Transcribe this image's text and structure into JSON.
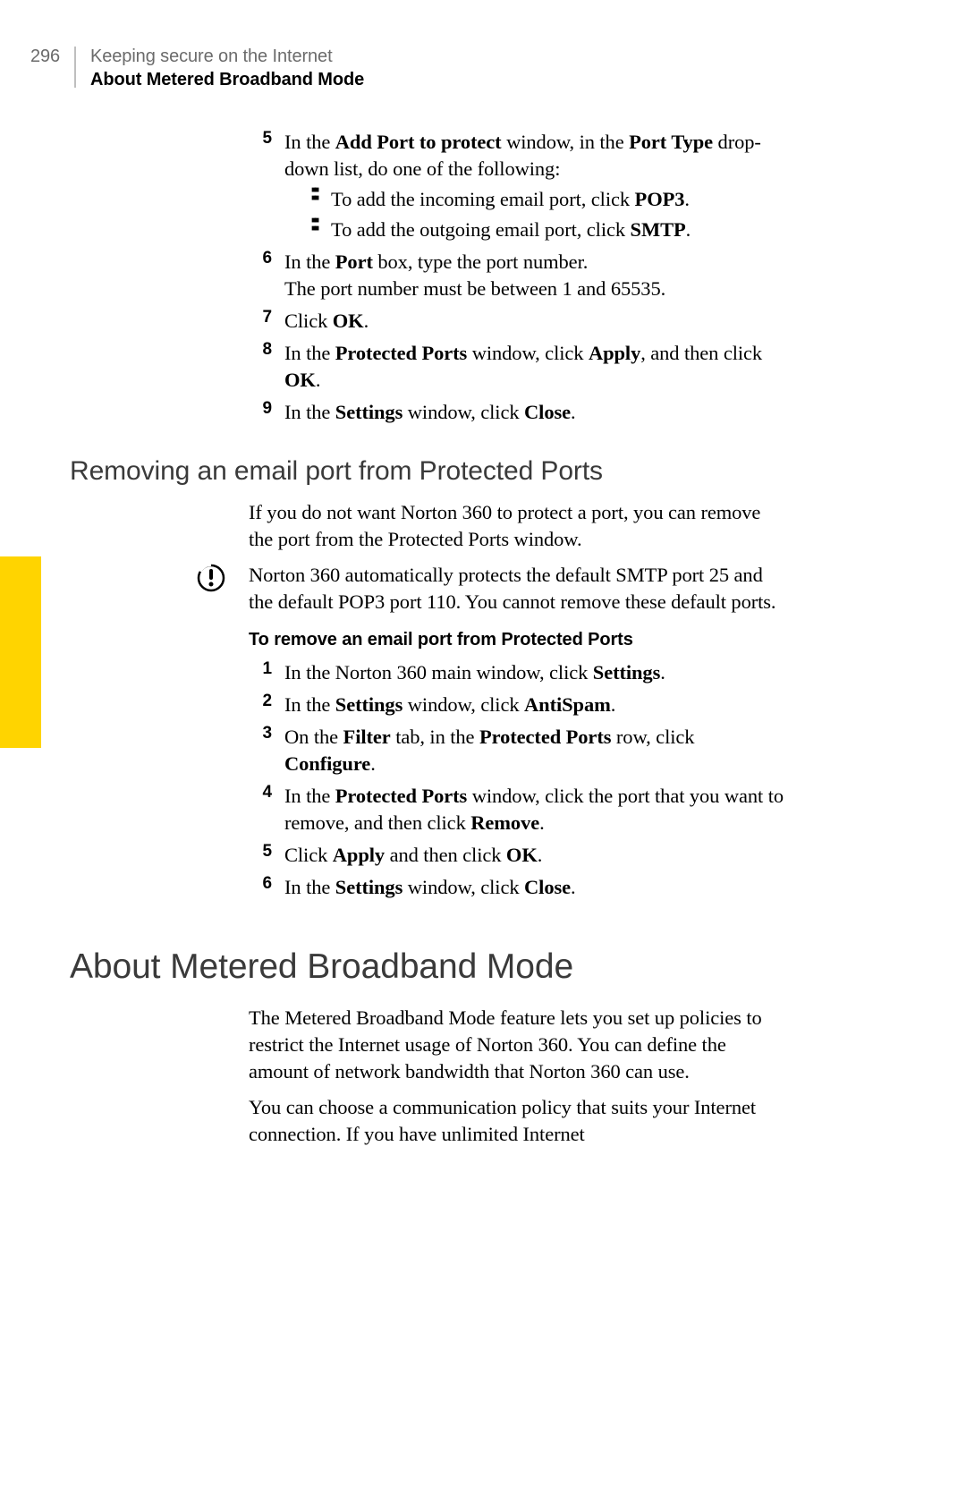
{
  "page_number": "296",
  "header_line1": "Keeping secure on the Internet",
  "header_line2": "About Metered Broadband Mode",
  "step5_pre": "In the ",
  "step5_b1": "Add Port to protect",
  "step5_mid1": " window, in the ",
  "step5_b2": "Port Type",
  "step5_post": " drop-down list, do one of the following:",
  "step5_sub1_pre": "To add the incoming email port, click ",
  "step5_sub1_b": "POP3",
  "step5_sub1_post": ".",
  "step5_sub2_pre": "To add the outgoing email port, click ",
  "step5_sub2_b": "SMTP",
  "step5_sub2_post": ".",
  "step6_pre": "In the ",
  "step6_b": "Port",
  "step6_post": " box, type the port number.",
  "step6_line2": "The port number must be between 1 and 65535.",
  "step7_pre": "Click ",
  "step7_b": "OK",
  "step7_post": ".",
  "step8_pre": "In the ",
  "step8_b1": "Protected Ports",
  "step8_mid": " window, click ",
  "step8_b2": "Apply",
  "step8_mid2": ", and then click ",
  "step8_b3": "OK",
  "step8_post": ".",
  "step9_pre": "In the ",
  "step9_b1": "Settings",
  "step9_mid": " window, click ",
  "step9_b2": "Close",
  "step9_post": ".",
  "h2_remove": "Removing an email port from Protected Ports",
  "remove_para_pre": "If you do not want Norton 360 to protect a port, you can remove the port from the ",
  "remove_para_b": "Protected Ports",
  "remove_para_post": " window.",
  "info_text": "Norton 360 automatically protects the default SMTP port 25 and the default POP3 port 110. You cannot remove these default ports.",
  "h3_remove": "To remove an email port from Protected Ports",
  "r1_pre": "In the Norton 360 main window, click ",
  "r1_b": "Settings",
  "r1_post": ".",
  "r2_pre": "In the ",
  "r2_b1": "Settings",
  "r2_mid": " window, click ",
  "r2_b2": "AntiSpam",
  "r2_post": ".",
  "r3_pre": "On the ",
  "r3_b1": "Filter",
  "r3_mid1": " tab, in the ",
  "r3_b2": "Protected Ports",
  "r3_mid2": " row, click ",
  "r3_b3": "Configure",
  "r3_post": ".",
  "r4_pre": "In the ",
  "r4_b1": "Protected Ports",
  "r4_mid": " window, click the port that you want to remove, and then click ",
  "r4_b2": "Remove",
  "r4_post": ".",
  "r5_pre": "Click ",
  "r5_b1": "Apply",
  "r5_mid": " and then click ",
  "r5_b2": "OK",
  "r5_post": ".",
  "r6_pre": "In the ",
  "r6_b1": "Settings",
  "r6_mid": " window, click ",
  "r6_b2": "Close",
  "r6_post": ".",
  "h1_metered": "About Metered Broadband Mode",
  "metered_p1": "The Metered Broadband Mode feature lets you set up policies to restrict the Internet usage of Norton 360. You can define the amount of network bandwidth that Norton 360 can use.",
  "metered_p2": "You can choose a communication policy that suits your Internet connection. If you have unlimited Internet",
  "numbers": {
    "n5": "5",
    "n6": "6",
    "n7": "7",
    "n8": "8",
    "n9": "9",
    "r1": "1",
    "r2": "2",
    "r3": "3",
    "r4": "4",
    "r5": "5",
    "r6": "6"
  }
}
